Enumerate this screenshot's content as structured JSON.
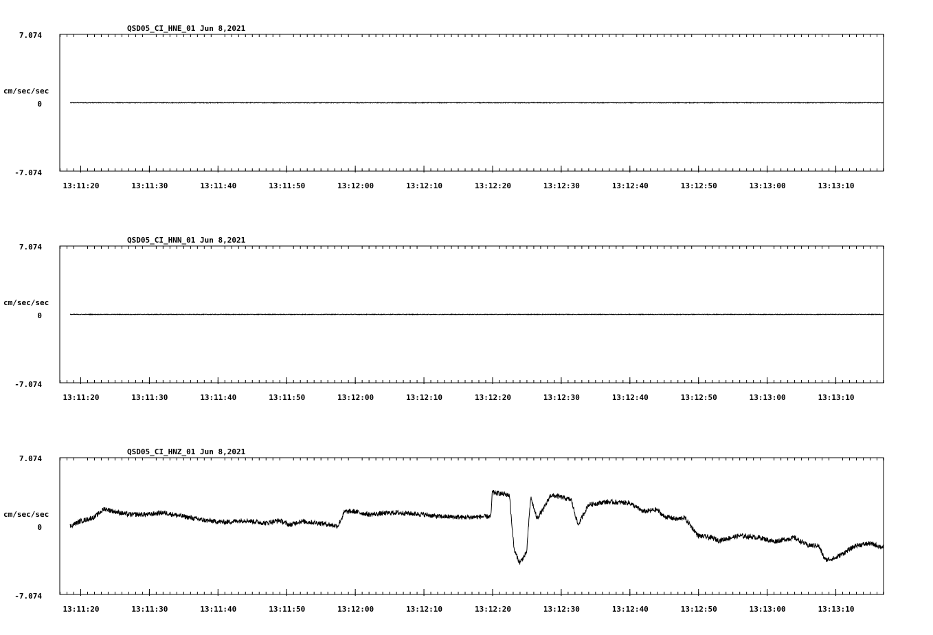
{
  "chart_data": [
    {
      "type": "line",
      "title": "QSD05_CI_HNE_01  Jun 8,2021",
      "ylabel": "cm/sec/sec",
      "ytick_labels": [
        "7.074",
        "0",
        "-7.074"
      ],
      "ylim": [
        -7.074,
        7.074
      ],
      "xlim_seconds_after_13_11_00": [
        17.0,
        137.0
      ],
      "xtick_labels": [
        "13:11:20",
        "13:11:30",
        "13:11:40",
        "13:11:50",
        "13:12:00",
        "13:12:10",
        "13:12:20",
        "13:12:30",
        "13:12:40",
        "13:12:50",
        "13:13:00",
        "13:13:10"
      ],
      "trace": {
        "start": 18.5,
        "end": 137.0,
        "amplitude": 0.03,
        "baseline": 0.0,
        "segments": []
      }
    },
    {
      "type": "line",
      "title": "QSD05_CI_HNN_01  Jun 8,2021",
      "ylabel": "cm/sec/sec",
      "ytick_labels": [
        "7.074",
        "0",
        "-7.074"
      ],
      "ylim": [
        -7.074,
        7.074
      ],
      "xlim_seconds_after_13_11_00": [
        17.0,
        137.0
      ],
      "xtick_labels": [
        "13:11:20",
        "13:11:30",
        "13:11:40",
        "13:11:50",
        "13:12:00",
        "13:12:10",
        "13:12:20",
        "13:12:30",
        "13:12:40",
        "13:12:50",
        "13:13:00",
        "13:13:10"
      ],
      "trace": {
        "start": 18.5,
        "end": 137.0,
        "amplitude": 0.03,
        "baseline": 0.0,
        "segments": []
      }
    },
    {
      "type": "line",
      "title": "QSD05_CI_HNZ_01  Jun 8,2021",
      "ylabel": "cm/sec/sec",
      "ytick_labels": [
        "7.074",
        "0",
        "-7.074"
      ],
      "ylim": [
        -7.074,
        7.074
      ],
      "xlim_seconds_after_13_11_00": [
        17.0,
        137.0
      ],
      "xtick_labels": [
        "13:11:20",
        "13:11:30",
        "13:11:40",
        "13:11:50",
        "13:12:00",
        "13:12:10",
        "13:12:20",
        "13:12:30",
        "13:12:40",
        "13:12:50",
        "13:13:00",
        "13:13:10"
      ],
      "trace": {
        "start": 18.5,
        "end": 137.0,
        "amplitude": 0.25,
        "baseline": 0.0,
        "segments": [
          [
            18.5,
            0.0
          ],
          [
            20.0,
            0.5
          ],
          [
            22.0,
            0.9
          ],
          [
            23.5,
            1.8
          ],
          [
            25.0,
            1.5
          ],
          [
            27.0,
            1.2
          ],
          [
            30.0,
            1.2
          ],
          [
            32.0,
            1.4
          ],
          [
            35.0,
            1.0
          ],
          [
            38.0,
            0.6
          ],
          [
            41.0,
            0.4
          ],
          [
            44.0,
            0.6
          ],
          [
            47.0,
            0.3
          ],
          [
            49.0,
            0.6
          ],
          [
            50.5,
            0.1
          ],
          [
            52.0,
            0.5
          ],
          [
            55.0,
            0.3
          ],
          [
            57.5,
            0.0
          ],
          [
            58.5,
            1.5
          ],
          [
            60.0,
            1.5
          ],
          [
            62.0,
            1.2
          ],
          [
            66.0,
            1.4
          ],
          [
            70.0,
            1.2
          ],
          [
            72.0,
            1.0
          ],
          [
            76.0,
            0.9
          ],
          [
            79.8,
            1.0
          ],
          [
            80.0,
            3.5
          ],
          [
            82.5,
            3.2
          ],
          [
            82.8,
            0.6
          ],
          [
            83.2,
            -2.5
          ],
          [
            84.0,
            -3.8
          ],
          [
            85.0,
            -2.8
          ],
          [
            85.6,
            3.0
          ],
          [
            86.5,
            0.8
          ],
          [
            87.5,
            1.8
          ],
          [
            88.5,
            3.2
          ],
          [
            90.0,
            3.0
          ],
          [
            91.5,
            2.7
          ],
          [
            92.5,
            0.1
          ],
          [
            94.0,
            2.2
          ],
          [
            96.5,
            2.5
          ],
          [
            100.0,
            2.4
          ],
          [
            102.0,
            1.5
          ],
          [
            104.0,
            1.7
          ],
          [
            105.0,
            1.0
          ],
          [
            107.0,
            0.7
          ],
          [
            108.0,
            0.9
          ],
          [
            110.0,
            -1.0
          ],
          [
            112.0,
            -1.2
          ],
          [
            113.0,
            -1.5
          ],
          [
            116.0,
            -1.0
          ],
          [
            119.0,
            -1.2
          ],
          [
            121.0,
            -1.6
          ],
          [
            124.0,
            -1.2
          ],
          [
            126.0,
            -2.0
          ],
          [
            127.5,
            -2.0
          ],
          [
            128.5,
            -3.5
          ],
          [
            130.0,
            -3.3
          ],
          [
            133.0,
            -2.0
          ],
          [
            135.0,
            -1.8
          ],
          [
            137.0,
            -2.2
          ]
        ]
      }
    }
  ]
}
